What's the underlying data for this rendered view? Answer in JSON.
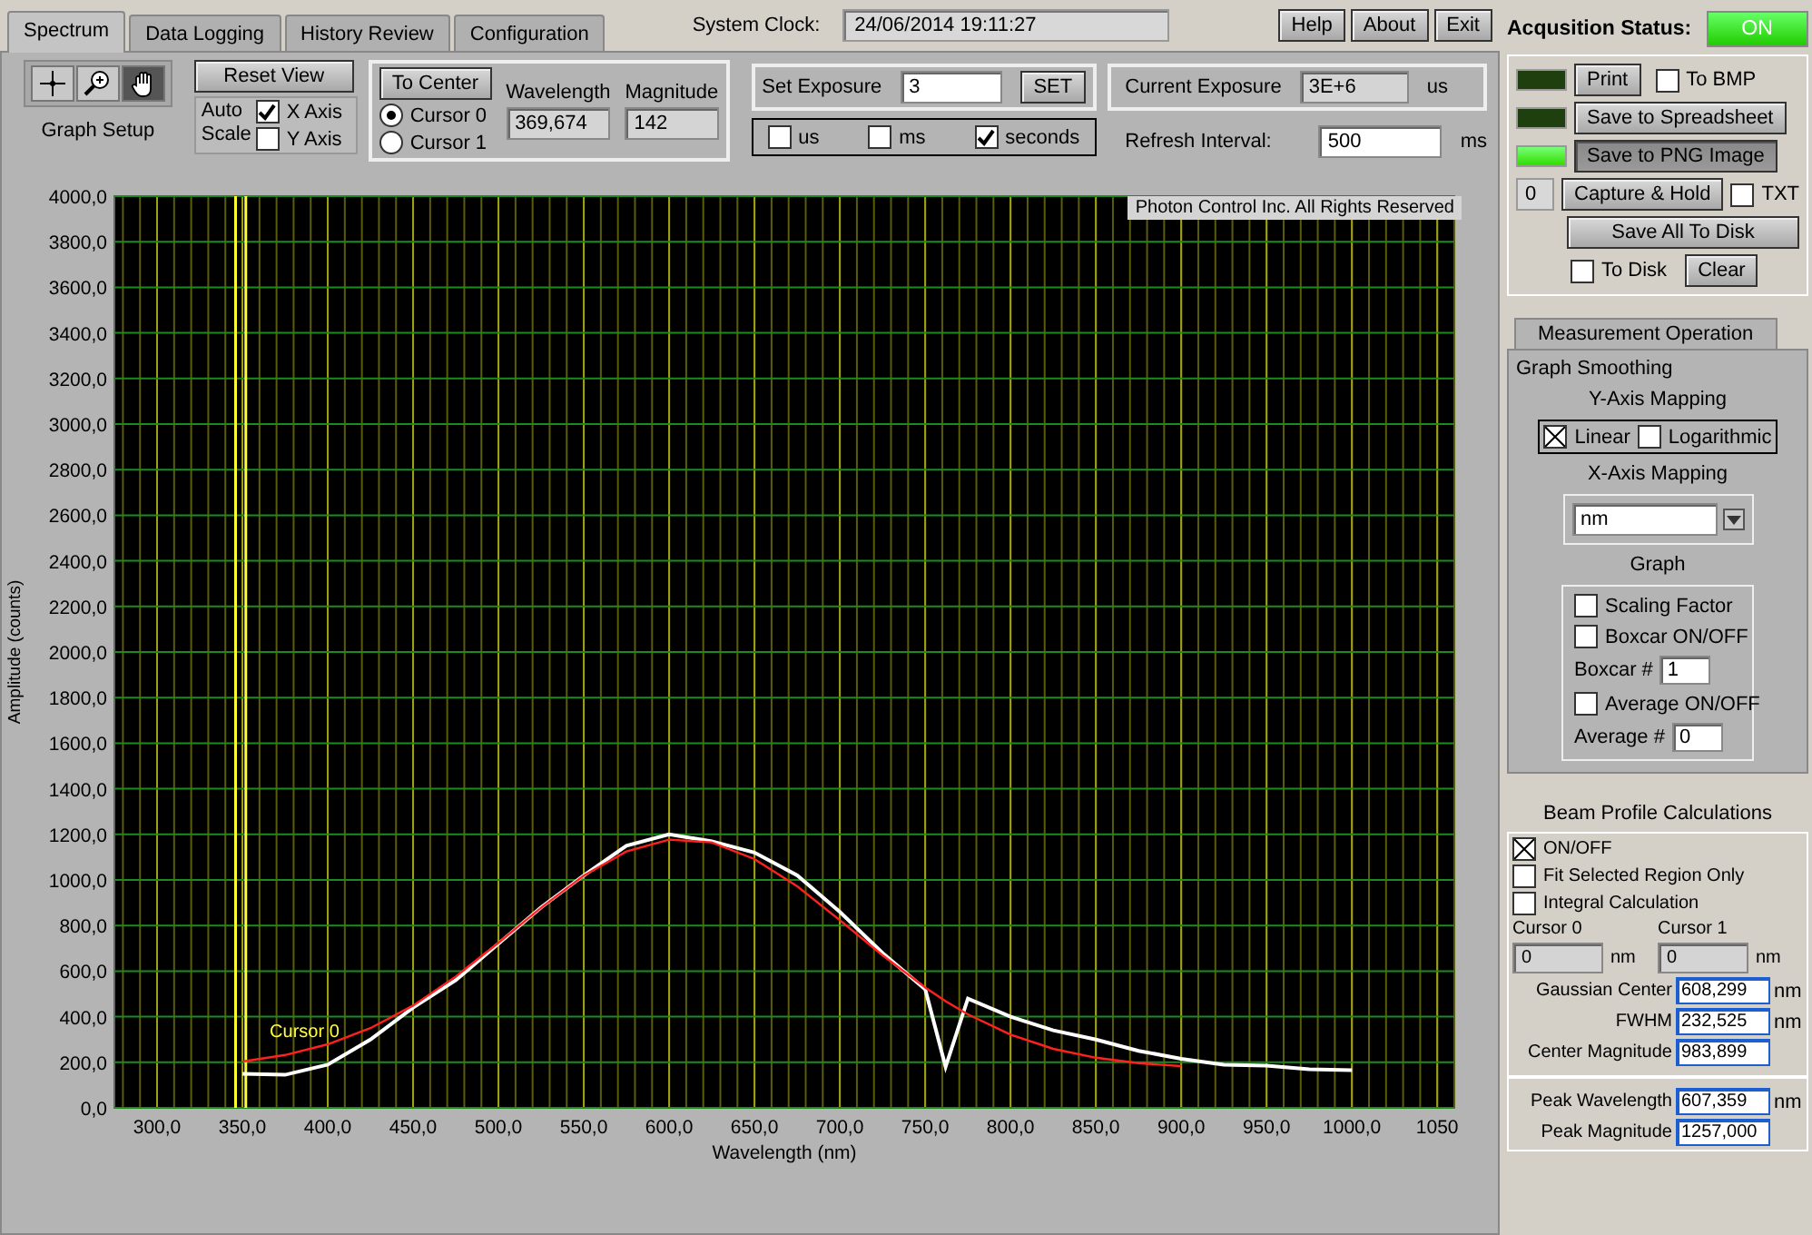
{
  "tabs": [
    {
      "label": "Spectrum",
      "selected": true
    },
    {
      "label": "Data Logging",
      "selected": false
    },
    {
      "label": "History Review",
      "selected": false
    },
    {
      "label": "Configuration",
      "selected": false
    }
  ],
  "system_clock": {
    "label": "System Clock:",
    "value": "24/06/2014 19:11:27"
  },
  "top_buttons": [
    "Help",
    "About",
    "Exit"
  ],
  "graph_setup": {
    "tools": [
      {
        "kind": "crosshair",
        "selected": false
      },
      {
        "kind": "zoom",
        "selected": false
      },
      {
        "kind": "pan",
        "selected": true
      }
    ],
    "label": "Graph Setup"
  },
  "reset_view": {
    "button": "Reset View",
    "auto_scale_label": "Auto Scale",
    "axes": [
      {
        "label": "X Axis",
        "checked": true
      },
      {
        "label": "Y Axis",
        "checked": false
      }
    ]
  },
  "cursor_panel": {
    "button": "To Center",
    "cursors": [
      {
        "label": "Cursor 0",
        "selected": true
      },
      {
        "label": "Cursor 1",
        "selected": false
      }
    ],
    "wavelength": {
      "label": "Wavelength",
      "value": "369,674"
    },
    "magnitude": {
      "label": "Magnitude",
      "value": "142"
    }
  },
  "exposure": {
    "label": "Set Exposure",
    "value": "3",
    "button": "SET",
    "units": [
      {
        "label": "us",
        "checked": false
      },
      {
        "label": "ms",
        "checked": false
      },
      {
        "label": "seconds",
        "checked": true
      }
    ]
  },
  "current_exposure": {
    "label": "Current Exposure",
    "value": "3E+6",
    "unit": "us"
  },
  "refresh": {
    "label": "Refresh Interval:",
    "value": "500",
    "unit": "ms"
  },
  "chart": {
    "copyright": "Photon Control Inc. All Rights Reserved",
    "chart_data": {
      "type": "line",
      "xlabel": "Wavelength (nm)",
      "ylabel": "Amplitude (counts)",
      "x": [
        350,
        375,
        400,
        425,
        450,
        475,
        500,
        525,
        550,
        575,
        600,
        625,
        650,
        675,
        700,
        725,
        750,
        762,
        775,
        800,
        825,
        850,
        875,
        900,
        925,
        950,
        975,
        1000
      ],
      "series": [
        {
          "color": "#ffffff",
          "values": [
            150,
            145,
            190,
            300,
            440,
            560,
            720,
            880,
            1020,
            1150,
            1200,
            1170,
            1120,
            1020,
            860,
            680,
            520,
            180,
            480,
            400,
            340,
            300,
            250,
            215,
            190,
            185,
            170,
            165
          ]
        },
        {
          "color": "#ff2020",
          "values": [
            203,
            232,
            279,
            350,
            449,
            576,
            724,
            878,
            1019,
            1125,
            1177,
            1165,
            1092,
            972,
            823,
            669,
            528,
            468,
            410,
            321,
            259,
            220,
            196,
            183,
            null,
            null,
            null,
            null
          ]
        }
      ],
      "xlim": [
        275,
        1060
      ],
      "ylim": [
        0,
        4000
      ],
      "xticks": [
        {
          "value": 300,
          "label": "300,0"
        },
        {
          "value": 350,
          "label": "350,0"
        },
        {
          "value": 400,
          "label": "400,0"
        },
        {
          "value": 450,
          "label": "450,0"
        },
        {
          "value": 500,
          "label": "500,0"
        },
        {
          "value": 550,
          "label": "550,0"
        },
        {
          "value": 600,
          "label": "600,0"
        },
        {
          "value": 650,
          "label": "650,0"
        },
        {
          "value": 700,
          "label": "700,0"
        },
        {
          "value": 750,
          "label": "750,0"
        },
        {
          "value": 800,
          "label": "800,0"
        },
        {
          "value": 850,
          "label": "850,0"
        },
        {
          "value": 900,
          "label": "900,0"
        },
        {
          "value": 950,
          "label": "950,0"
        },
        {
          "value": 1000,
          "label": "1000,0"
        },
        {
          "value": 1050,
          "label": "1050"
        }
      ],
      "yticks": [
        {
          "value": 0,
          "label": "0,0"
        },
        {
          "value": 200,
          "label": "200,0"
        },
        {
          "value": 400,
          "label": "400,0"
        },
        {
          "value": 600,
          "label": "600,0"
        },
        {
          "value": 800,
          "label": "800,0"
        },
        {
          "value": 1000,
          "label": "1000,0"
        },
        {
          "value": 1200,
          "label": "1200,0"
        },
        {
          "value": 1400,
          "label": "1400,0"
        },
        {
          "value": 1600,
          "label": "1600,0"
        },
        {
          "value": 1800,
          "label": "1800,0"
        },
        {
          "value": 2000,
          "label": "2000,0"
        },
        {
          "value": 2200,
          "label": "2200,0"
        },
        {
          "value": 2400,
          "label": "2400,0"
        },
        {
          "value": 2600,
          "label": "2600,0"
        },
        {
          "value": 2800,
          "label": "2800,0"
        },
        {
          "value": 3000,
          "label": "3000,0"
        },
        {
          "value": 3200,
          "label": "3200,0"
        },
        {
          "value": 3400,
          "label": "3400,0"
        },
        {
          "value": 3600,
          "label": "3600,0"
        },
        {
          "value": 3800,
          "label": "3800,0"
        },
        {
          "value": 4000,
          "label": "4000,0"
        }
      ],
      "grid": true,
      "ref_lines": [
        {
          "axis": "x",
          "value": 346,
          "color": "#ffff30"
        },
        {
          "axis": "x",
          "value": 352,
          "color": "#ffff30"
        }
      ],
      "annotations": [
        {
          "x": 366,
          "y": 215,
          "text": "Cursor 0"
        }
      ]
    }
  },
  "acquisition": {
    "label": "Acqusition Status:",
    "status": "ON",
    "on": true
  },
  "export": {
    "print": {
      "led_on": false,
      "label": "Print"
    },
    "to_bmp": {
      "label": "To BMP",
      "checked": false
    },
    "spreadsheet": {
      "led_on": false,
      "label": "Save to Spreadsheet"
    },
    "png": {
      "led_on": true,
      "label": "Save to PNG Image",
      "pressed": true
    },
    "count": "0",
    "capture": {
      "label": "Capture & Hold"
    },
    "txt": {
      "label": "TXT",
      "checked": false
    },
    "save_all": "Save All To Disk",
    "to_disk": {
      "label": "To Disk",
      "checked": false
    },
    "clear": "Clear"
  },
  "measurement": {
    "tab": "Measurement Operation",
    "title": "Graph Smoothing",
    "y_mapping": {
      "label": "Y-Axis Mapping",
      "options": [
        {
          "label": "Linear",
          "checked": true
        },
        {
          "label": "Logarithmic",
          "checked": false
        }
      ]
    },
    "x_mapping": {
      "label": "X-Axis Mapping",
      "value": "nm"
    },
    "graph": {
      "label": "Graph",
      "scaling": {
        "label": "Scaling Factor",
        "checked": false
      },
      "boxcar": {
        "label": "Boxcar ON/OFF",
        "checked": false
      },
      "boxcar_n": {
        "label": "Boxcar #",
        "value": "1"
      },
      "average": {
        "label": "Average ON/OFF",
        "checked": false
      },
      "average_n": {
        "label": "Average #",
        "value": "0"
      }
    }
  },
  "beam_profile": {
    "title": "Beam Profile Calculations",
    "options": [
      {
        "label": "ON/OFF",
        "checked": true
      },
      {
        "label": "Fit Selected Region Only",
        "checked": false
      },
      {
        "label": "Integral Calculation",
        "checked": false
      }
    ],
    "cursors": [
      {
        "label": "Cursor 0",
        "value": "0",
        "unit": "nm"
      },
      {
        "label": "Cursor 1",
        "value": "0",
        "unit": "nm"
      }
    ],
    "results": [
      {
        "label": "Gaussian Center",
        "value": "608,299",
        "unit": "nm"
      },
      {
        "label": "FWHM",
        "value": "232,525",
        "unit": "nm"
      },
      {
        "label": "Center Magnitude",
        "value": "983,899"
      }
    ],
    "peak": [
      {
        "label": "Peak Wavelength",
        "value": "607,359",
        "unit": "nm"
      },
      {
        "label": "Peak Magnitude",
        "value": "1257,000"
      }
    ]
  }
}
